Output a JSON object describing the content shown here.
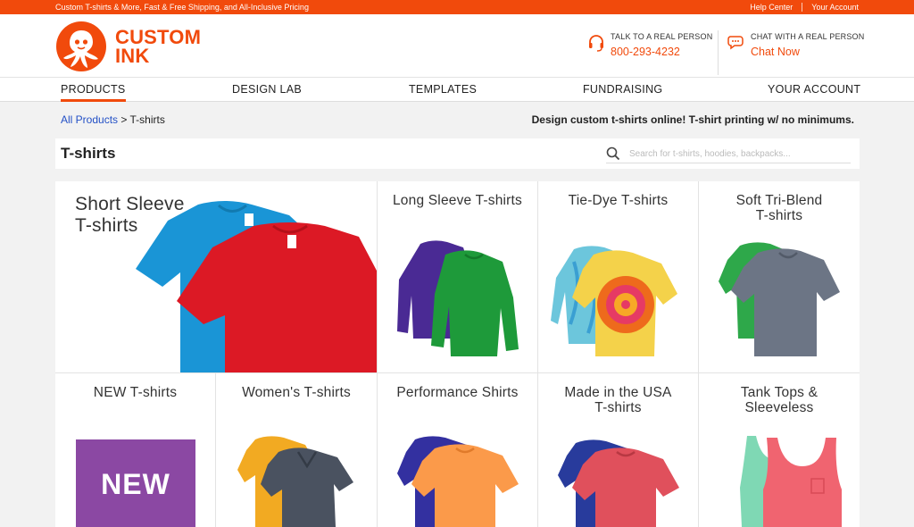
{
  "topbar": {
    "promo": "Custom T-shirts & More, Fast & Free Shipping, and All-Inclusive Pricing",
    "help": "Help Center",
    "account": "Your Account"
  },
  "header": {
    "logo_line1": "CUSTOM",
    "logo_line2": "INK",
    "phone_label": "TALK TO A REAL PERSON",
    "phone_number": "800-293-4232",
    "chat_label": "CHAT WITH A REAL PERSON",
    "chat_link": "Chat Now"
  },
  "nav": {
    "items": [
      "PRODUCTS",
      "DESIGN LAB",
      "TEMPLATES",
      "FUNDRAISING",
      "YOUR ACCOUNT"
    ],
    "active": "PRODUCTS"
  },
  "breadcrumb": {
    "root": "All Products",
    "separator": " > ",
    "current": "T-shirts"
  },
  "tagline": "Design custom t-shirts online! T-shirt printing w/ no minimums.",
  "page": {
    "title": "T-shirts",
    "search_placeholder": "Search for t-shirts, hoodies, backpacks..."
  },
  "categories": [
    {
      "line1": "Short Sleeve",
      "line2": "T-shirts"
    },
    {
      "line1": "Long Sleeve T-shirts",
      "line2": ""
    },
    {
      "line1": "Tie-Dye T-shirts",
      "line2": ""
    },
    {
      "line1": "Soft Tri-Blend",
      "line2": "T-shirts"
    },
    {
      "line1": "NEW T-shirts",
      "line2": "",
      "badge": "NEW"
    },
    {
      "line1": "Women's T-shirts",
      "line2": ""
    },
    {
      "line1": "Performance Shirts",
      "line2": ""
    },
    {
      "line1": "Made in the USA",
      "line2": "T-shirts"
    },
    {
      "line1": "Tank Tops &",
      "line2": "Sleeveless"
    }
  ],
  "colors": {
    "brand": "#f14a0c",
    "link": "#2350c6",
    "new_badge": "#8b48a3"
  }
}
